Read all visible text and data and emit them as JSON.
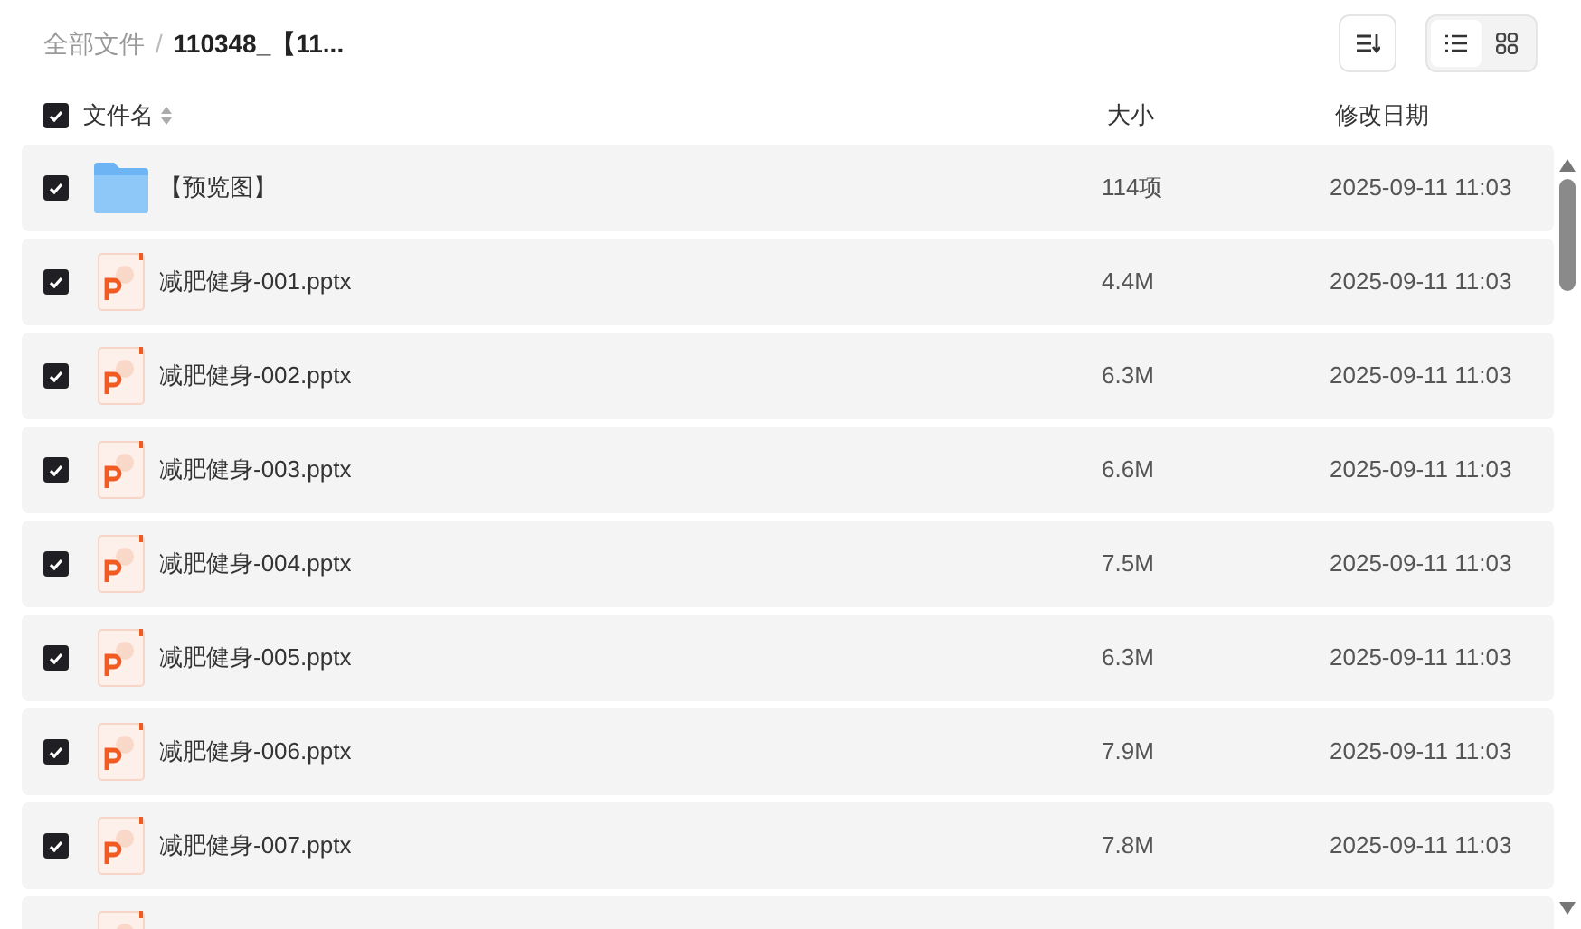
{
  "breadcrumb": {
    "root": "全部文件",
    "separator": "/",
    "current": "110348_【11..."
  },
  "view_toggle": [
    {
      "kind": "list",
      "selected": true
    },
    {
      "kind": "grid",
      "selected": false
    }
  ],
  "header": {
    "checked": true,
    "name": "文件名",
    "size": "大小",
    "date": "修改日期"
  },
  "rows": [
    {
      "kind": "folder",
      "checked": true,
      "name": "【预览图】",
      "size": "114项",
      "date": "2025-09-11 11:03"
    },
    {
      "kind": "pptx",
      "checked": true,
      "name": "减肥健身-001.pptx",
      "size": "4.4M",
      "date": "2025-09-11 11:03"
    },
    {
      "kind": "pptx",
      "checked": true,
      "name": "减肥健身-002.pptx",
      "size": "6.3M",
      "date": "2025-09-11 11:03"
    },
    {
      "kind": "pptx",
      "checked": true,
      "name": "减肥健身-003.pptx",
      "size": "6.6M",
      "date": "2025-09-11 11:03"
    },
    {
      "kind": "pptx",
      "checked": true,
      "name": "减肥健身-004.pptx",
      "size": "7.5M",
      "date": "2025-09-11 11:03"
    },
    {
      "kind": "pptx",
      "checked": true,
      "name": "减肥健身-005.pptx",
      "size": "6.3M",
      "date": "2025-09-11 11:03"
    },
    {
      "kind": "pptx",
      "checked": true,
      "name": "减肥健身-006.pptx",
      "size": "7.9M",
      "date": "2025-09-11 11:03"
    },
    {
      "kind": "pptx",
      "checked": true,
      "name": "减肥健身-007.pptx",
      "size": "7.8M",
      "date": "2025-09-11 11:03"
    },
    {
      "kind": "pptx"
    }
  ]
}
